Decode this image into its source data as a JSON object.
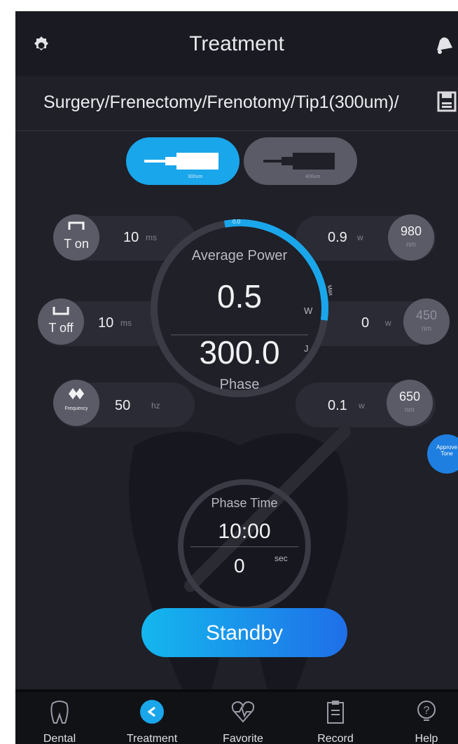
{
  "header": {
    "title": "Treatment",
    "settings_icon": "gear-icon",
    "notification_icon": "bell-icon"
  },
  "path": {
    "text": "Surgery/Frenectomy/Frenotomy/Tip1(300um)/",
    "save_icon": "save-icon"
  },
  "tips": [
    {
      "label": "300um",
      "active": true
    },
    {
      "label": "400um",
      "active": false
    }
  ],
  "params": {
    "t_on": {
      "label": "T on",
      "value": "10",
      "unit": "ms"
    },
    "t_off": {
      "label": "T off",
      "value": "10",
      "unit": "ms"
    },
    "frequency": {
      "label": "Frequency",
      "value": "50",
      "unit": "hz"
    }
  },
  "wavelengths": {
    "w980": {
      "label": "980",
      "unit_label": "nm",
      "value": "0.9",
      "unit": "w"
    },
    "w450": {
      "label": "450",
      "unit_label": "nm",
      "value": "0",
      "unit": "w"
    },
    "w650": {
      "label": "650",
      "unit_label": "nm",
      "value": "0.1",
      "unit": "w"
    }
  },
  "gauge": {
    "title": "Average Power",
    "power": "0.5",
    "power_unit": "W",
    "energy": "300.0",
    "energy_unit": "J",
    "sub": "Phase",
    "progress_fraction": 0.3,
    "start_marker": "0.0",
    "end_marker": "Max"
  },
  "approve_button": {
    "label_line1": "Approve",
    "label_line2": "Tone"
  },
  "phase_time": {
    "title": "Phase Time",
    "time": "10:00",
    "seconds": "0",
    "seconds_unit": "sec"
  },
  "standby_label": "Standby",
  "nav": [
    {
      "label": "Dental",
      "icon": "tooth-icon"
    },
    {
      "label": "Treatment",
      "icon": "treatment-icon",
      "active": true
    },
    {
      "label": "Favorite",
      "icon": "heart-icon"
    },
    {
      "label": "Record",
      "icon": "clipboard-icon"
    },
    {
      "label": "Help",
      "icon": "help-icon"
    }
  ],
  "colors": {
    "accent": "#1aa6ea",
    "background": "#1f2028",
    "button_gray": "#5a5b66"
  }
}
